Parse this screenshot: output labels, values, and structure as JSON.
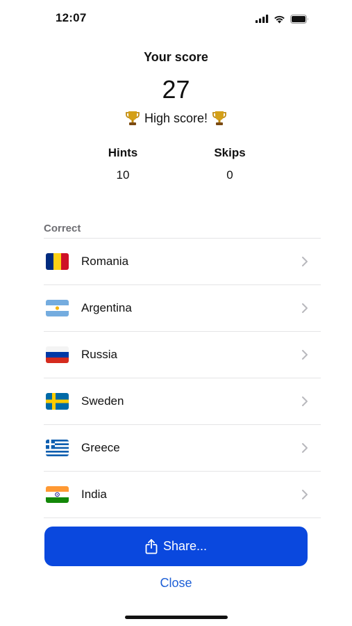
{
  "status_bar": {
    "time": "12:07",
    "icons": [
      "cellular-signal-icon",
      "wifi-icon",
      "battery-icon"
    ]
  },
  "score": {
    "title": "Your score",
    "value": "27",
    "high_score_text": "High score!",
    "high_score_icon": "trophy-icon"
  },
  "stats": {
    "hints_label": "Hints",
    "hints_value": "10",
    "skips_label": "Skips",
    "skips_value": "0"
  },
  "section": {
    "label": "Correct"
  },
  "countries": [
    {
      "name": "Romania",
      "flag": "romania-flag-icon"
    },
    {
      "name": "Argentina",
      "flag": "argentina-flag-icon"
    },
    {
      "name": "Russia",
      "flag": "russia-flag-icon"
    },
    {
      "name": "Sweden",
      "flag": "sweden-flag-icon"
    },
    {
      "name": "Greece",
      "flag": "greece-flag-icon"
    },
    {
      "name": "India",
      "flag": "india-flag-icon"
    }
  ],
  "actions": {
    "share_label": "Share...",
    "share_icon": "share-icon",
    "close_label": "Close"
  },
  "colors": {
    "accent": "#0a48de",
    "link": "#1d5fd6",
    "secondary_text": "#6e6e73"
  }
}
